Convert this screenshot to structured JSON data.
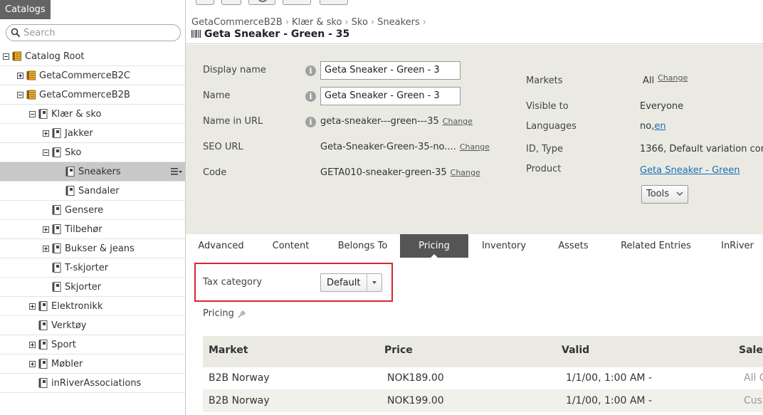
{
  "left_panel": {
    "title": "Catalogs",
    "search": {
      "placeholder": "Search",
      "value": ""
    },
    "tree": [
      {
        "label": "Catalog Root",
        "level": 0,
        "toggle": "minus",
        "icon": "catalog-icon"
      },
      {
        "label": "GetaCommerceB2C",
        "level": 1,
        "toggle": "plus",
        "icon": "catalog-icon"
      },
      {
        "label": "GetaCommerceB2B",
        "level": 1,
        "toggle": "minus",
        "icon": "catalog-icon"
      },
      {
        "label": "Klær & sko",
        "level": 2,
        "toggle": "minus",
        "icon": "node-icon"
      },
      {
        "label": "Jakker",
        "level": 3,
        "toggle": "plus",
        "icon": "node-icon"
      },
      {
        "label": "Sko",
        "level": 3,
        "toggle": "minus",
        "icon": "node-icon"
      },
      {
        "label": "Sneakers",
        "level": 4,
        "toggle": "none",
        "icon": "node-icon",
        "selected": true
      },
      {
        "label": "Sandaler",
        "level": 4,
        "toggle": "none",
        "icon": "node-icon"
      },
      {
        "label": "Gensere",
        "level": 3,
        "toggle": "none",
        "icon": "node-icon"
      },
      {
        "label": "Tilbehør",
        "level": 3,
        "toggle": "plus",
        "icon": "node-icon"
      },
      {
        "label": "Bukser & jeans",
        "level": 3,
        "toggle": "plus",
        "icon": "node-icon"
      },
      {
        "label": "T-skjorter",
        "level": 3,
        "toggle": "none",
        "icon": "node-icon"
      },
      {
        "label": "Skjorter",
        "level": 3,
        "toggle": "none",
        "icon": "node-icon"
      },
      {
        "label": "Elektronikk",
        "level": 2,
        "toggle": "plus",
        "icon": "node-icon"
      },
      {
        "label": "Verktøy",
        "level": 2,
        "toggle": "none",
        "icon": "node-icon"
      },
      {
        "label": "Sport",
        "level": 2,
        "toggle": "plus",
        "icon": "node-icon"
      },
      {
        "label": "Møbler",
        "level": 2,
        "toggle": "plus",
        "icon": "node-icon"
      },
      {
        "label": "inRiverAssociations",
        "level": 2,
        "toggle": "none",
        "icon": "node-icon"
      }
    ]
  },
  "header": {
    "breadcrumb": [
      "GetaCommerceB2B",
      "Klær & sko",
      "Sko",
      "Sneakers"
    ],
    "title": "Geta Sneaker - Green - 35"
  },
  "properties": {
    "display_name": {
      "label": "Display name",
      "value": "Geta Sneaker - Green - 3"
    },
    "name": {
      "label": "Name",
      "value": "Geta Sneaker - Green - 3"
    },
    "name_in_url": {
      "label": "Name in URL",
      "value": "geta-sneaker---green---35",
      "change": "Change"
    },
    "seo_url": {
      "label": "SEO URL",
      "value": "Geta-Sneaker-Green-35-no....",
      "change": "Change"
    },
    "code": {
      "label": "Code",
      "value": "GETA010-sneaker-green-35",
      "change": "Change"
    },
    "markets": {
      "label": "Markets",
      "value": "All",
      "change": "Change"
    },
    "visible_to": {
      "label": "Visible to",
      "value": "Everyone"
    },
    "languages": {
      "label": "Languages",
      "value": "no,",
      "link": "en"
    },
    "id_type": {
      "label": "ID, Type",
      "value": "1366, Default variation con"
    },
    "product": {
      "label": "Product",
      "link": "Geta Sneaker - Green"
    },
    "tools_label": "Tools"
  },
  "tabs": [
    "Advanced",
    "Content",
    "Belongs To",
    "Pricing",
    "Inventory",
    "Assets",
    "Related Entries",
    "InRiver"
  ],
  "active_tab": "Pricing",
  "tax": {
    "label": "Tax category",
    "value": "Default"
  },
  "pricing": {
    "label": "Pricing",
    "columns": [
      "Market",
      "Price",
      "Valid",
      "Sale"
    ],
    "rows": [
      {
        "market": "B2B Norway",
        "price": "NOK189.00",
        "valid": "1/1/00, 1:00 AM -",
        "sale": "All C"
      },
      {
        "market": "B2B Norway",
        "price": "NOK199.00",
        "valid": "1/1/00, 1:00 AM -",
        "sale": "Cus"
      }
    ]
  },
  "colors": {
    "accent_border": "#d8262e",
    "tab_active_bg": "#555555",
    "panel_bg": "#eaeae3",
    "link": "#1a6fb5"
  }
}
